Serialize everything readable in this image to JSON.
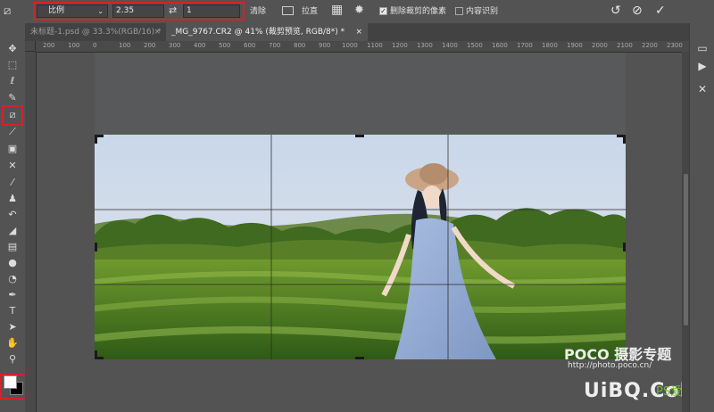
{
  "options_bar": {
    "tool_icon": "crop-icon",
    "ratio_mode": "比例",
    "width_value": "2.35",
    "height_value": "1",
    "clear_label": "清除",
    "straighten_label": "拉直",
    "delete_cropped_label": "删除裁剪的像素",
    "delete_cropped_checked": true,
    "content_aware_label": "内容识别",
    "content_aware_checked": false
  },
  "tabs": [
    {
      "label": "未标题-1.psd @ 33.3%(RGB/16) *",
      "active": false
    },
    {
      "label": "_MG_9767.CR2 @ 41% (裁剪预览, RGB/8*) *",
      "active": true
    }
  ],
  "ruler": {
    "top_ticks": [
      "200",
      "100",
      "0",
      "100",
      "200",
      "300",
      "400",
      "500",
      "600",
      "700",
      "800",
      "900",
      "1000",
      "1100",
      "1200",
      "1300",
      "1400",
      "1500",
      "1600",
      "1700",
      "1800",
      "1900",
      "2000",
      "2100",
      "2200",
      "2300"
    ]
  },
  "watermark": {
    "line1": "POCO 摄影专题",
    "line2": "http://photo.poco.cn/",
    "line3": "UiBQ.CoM",
    "line4": "PS爱好者"
  },
  "colors": {
    "highlight": "#d2232a",
    "foreground": "#ffffff",
    "background": "#000000"
  }
}
